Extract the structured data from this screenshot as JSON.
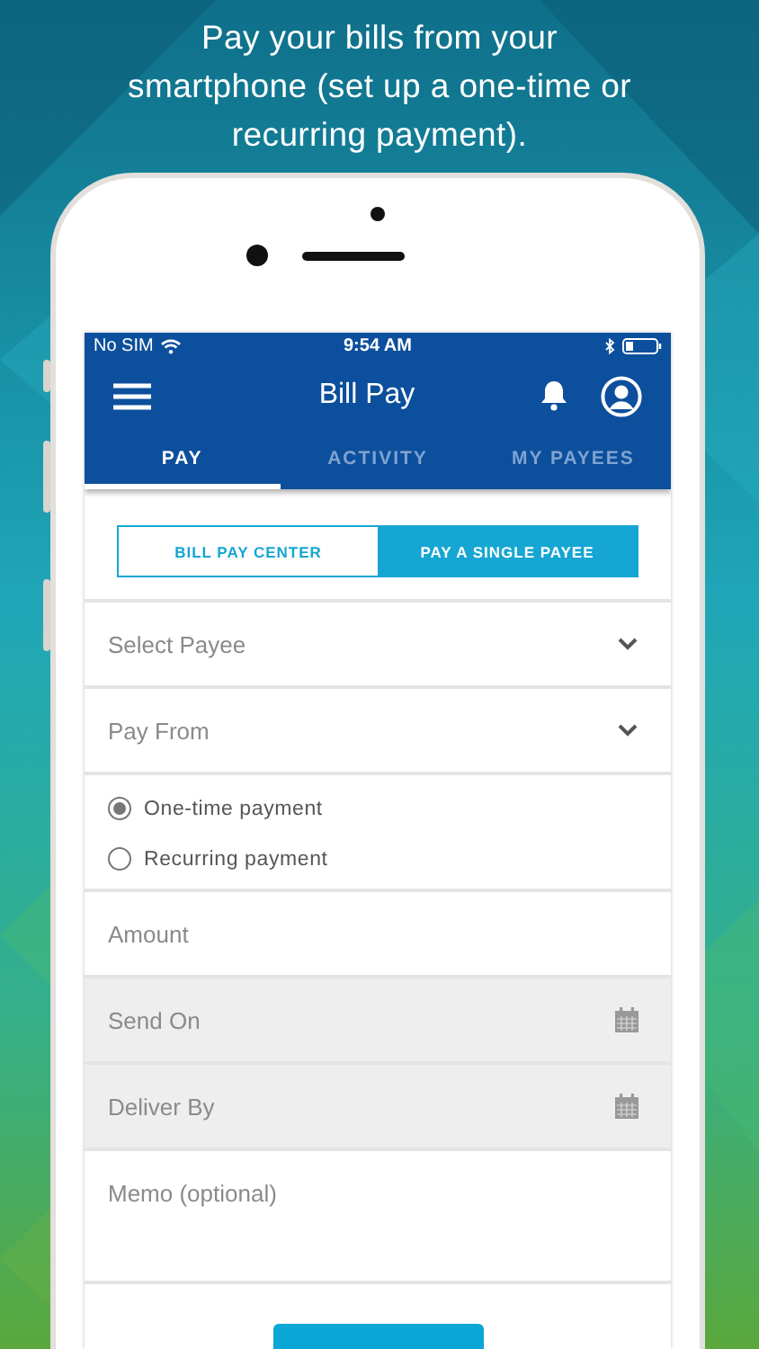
{
  "caption": "Pay your bills from your smartphone (set up a one-time or recurring payment).",
  "status_bar": {
    "carrier": "No SIM",
    "time": "9:54 AM"
  },
  "header": {
    "title": "Bill Pay"
  },
  "tabs": [
    {
      "label": "PAY",
      "selected": true
    },
    {
      "label": "ACTIVITY",
      "selected": false
    },
    {
      "label": "MY PAYEES",
      "selected": false
    }
  ],
  "segments": [
    {
      "label": "BILL PAY CENTER",
      "selected": false
    },
    {
      "label": "PAY A SINGLE PAYEE",
      "selected": true
    }
  ],
  "form": [
    {
      "kind": "dropdown",
      "placeholder": "Select Payee"
    },
    {
      "kind": "dropdown",
      "placeholder": "Pay From"
    },
    {
      "kind": "radios",
      "options": [
        {
          "label": "One-time payment",
          "selected": true
        },
        {
          "label": "Recurring payment",
          "selected": false
        }
      ]
    },
    {
      "kind": "text",
      "placeholder": "Amount"
    },
    {
      "kind": "date",
      "placeholder": "Send On"
    },
    {
      "kind": "date",
      "placeholder": "Deliver By"
    },
    {
      "kind": "memo",
      "placeholder": "Memo (optional)"
    }
  ]
}
